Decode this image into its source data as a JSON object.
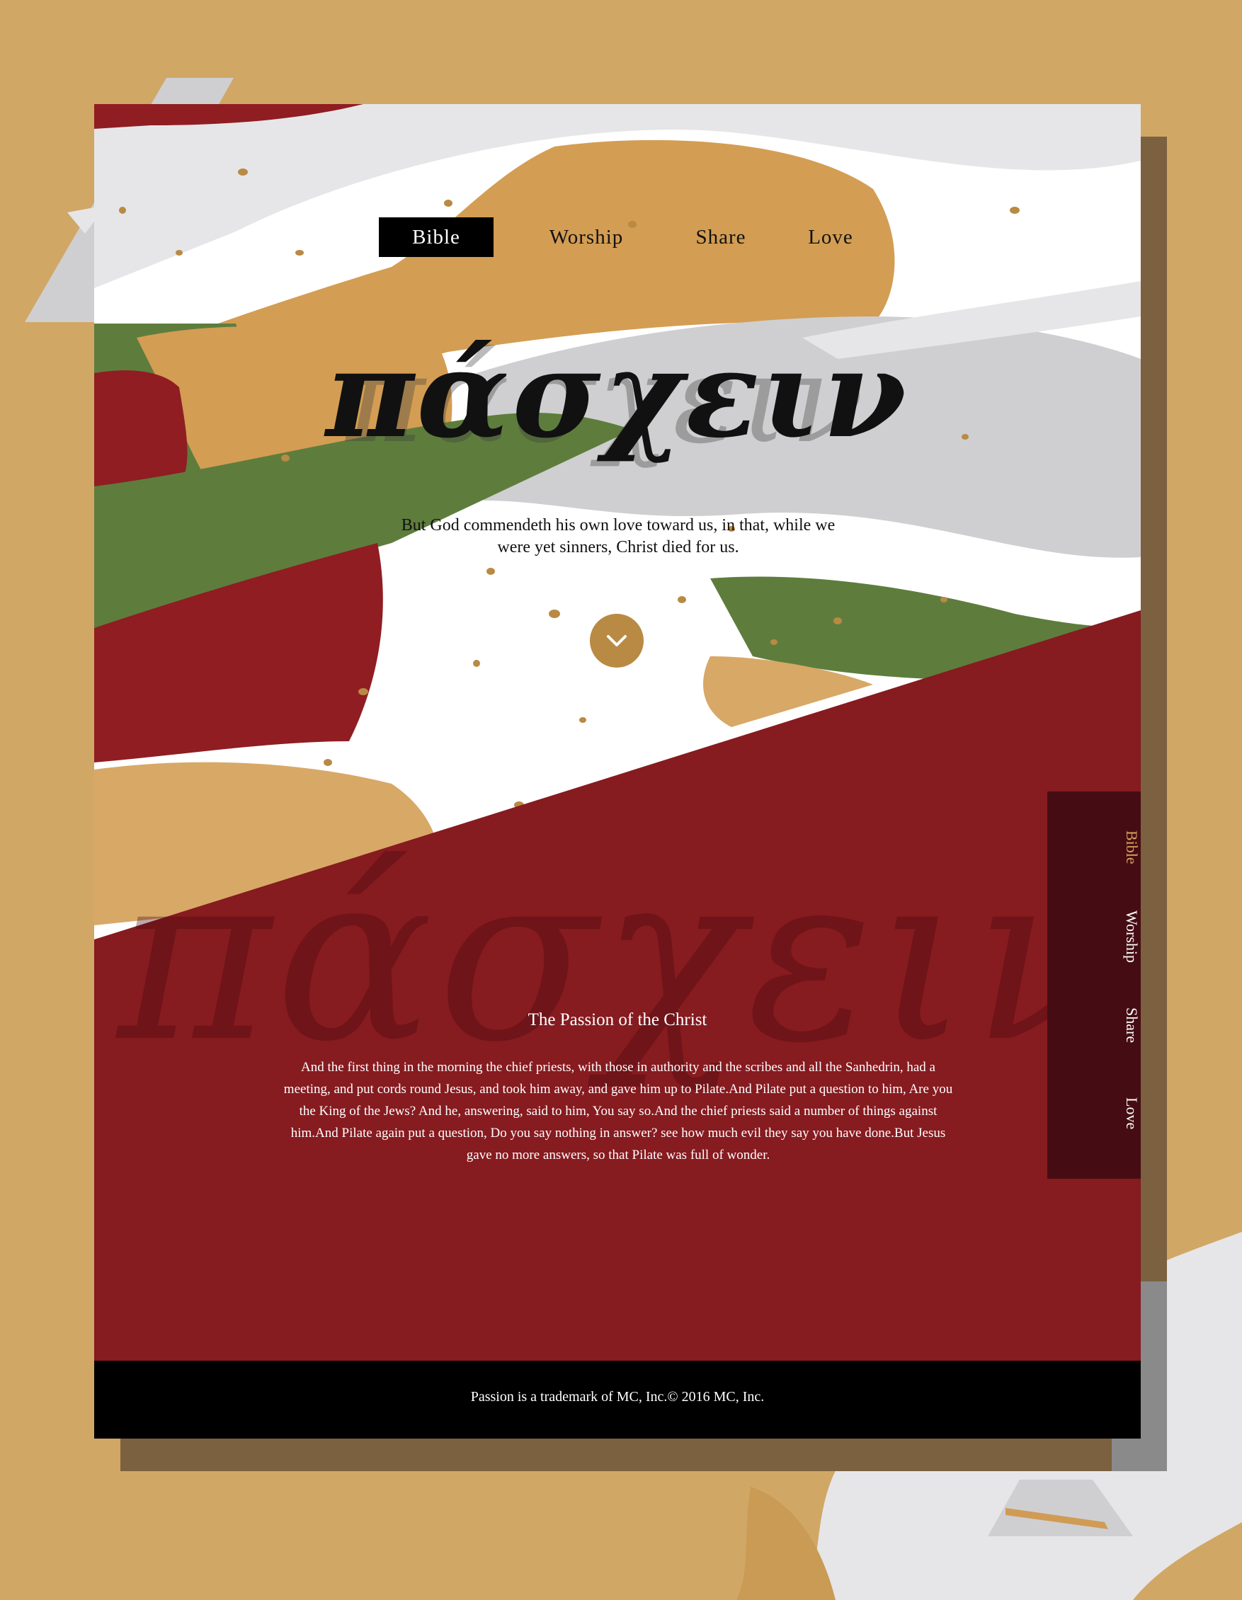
{
  "colors": {
    "background": "#d1a765",
    "gold": "#d39d53",
    "crimson": "#861b20",
    "dark_crimson": "#450d13",
    "green": "#5e7d3d",
    "light_gray": "#e6e6e8",
    "black": "#000000"
  },
  "nav": {
    "items": [
      {
        "label": "Bible",
        "active": true
      },
      {
        "label": "Worship",
        "active": false
      },
      {
        "label": "Share",
        "active": false
      },
      {
        "label": "Love",
        "active": false
      }
    ]
  },
  "hero": {
    "title": "πάσχειν",
    "quote": "But God commendeth his own love toward us, in that, while we were yet sinners, Christ died for us.",
    "scroll_icon": "chevron-down-icon"
  },
  "section": {
    "watermark": "πάσχειν",
    "heading": "The Passion of the Christ",
    "body": "And the first thing in the morning the chief priests, with those in authority and the scribes and all the Sanhedrin, had a meeting, and put cords round Jesus, and took him away, and gave him up to Pilate.And Pilate put a question to him, Are you the King of the Jews? And he, answering, said to him, You say so.And the chief priests said a number of things against him.And Pilate again put a question, Do you say nothing in answer? see how much evil they say you have done.But Jesus gave no more answers, so that Pilate was full of wonder."
  },
  "side_nav": {
    "items": [
      {
        "label": "Bible",
        "active": true
      },
      {
        "label": "Worship",
        "active": false
      },
      {
        "label": "Share",
        "active": false
      },
      {
        "label": "Love",
        "active": false
      }
    ]
  },
  "footer": {
    "text": "Passion is a trademark of MC, Inc.© 2016 MC, Inc."
  }
}
